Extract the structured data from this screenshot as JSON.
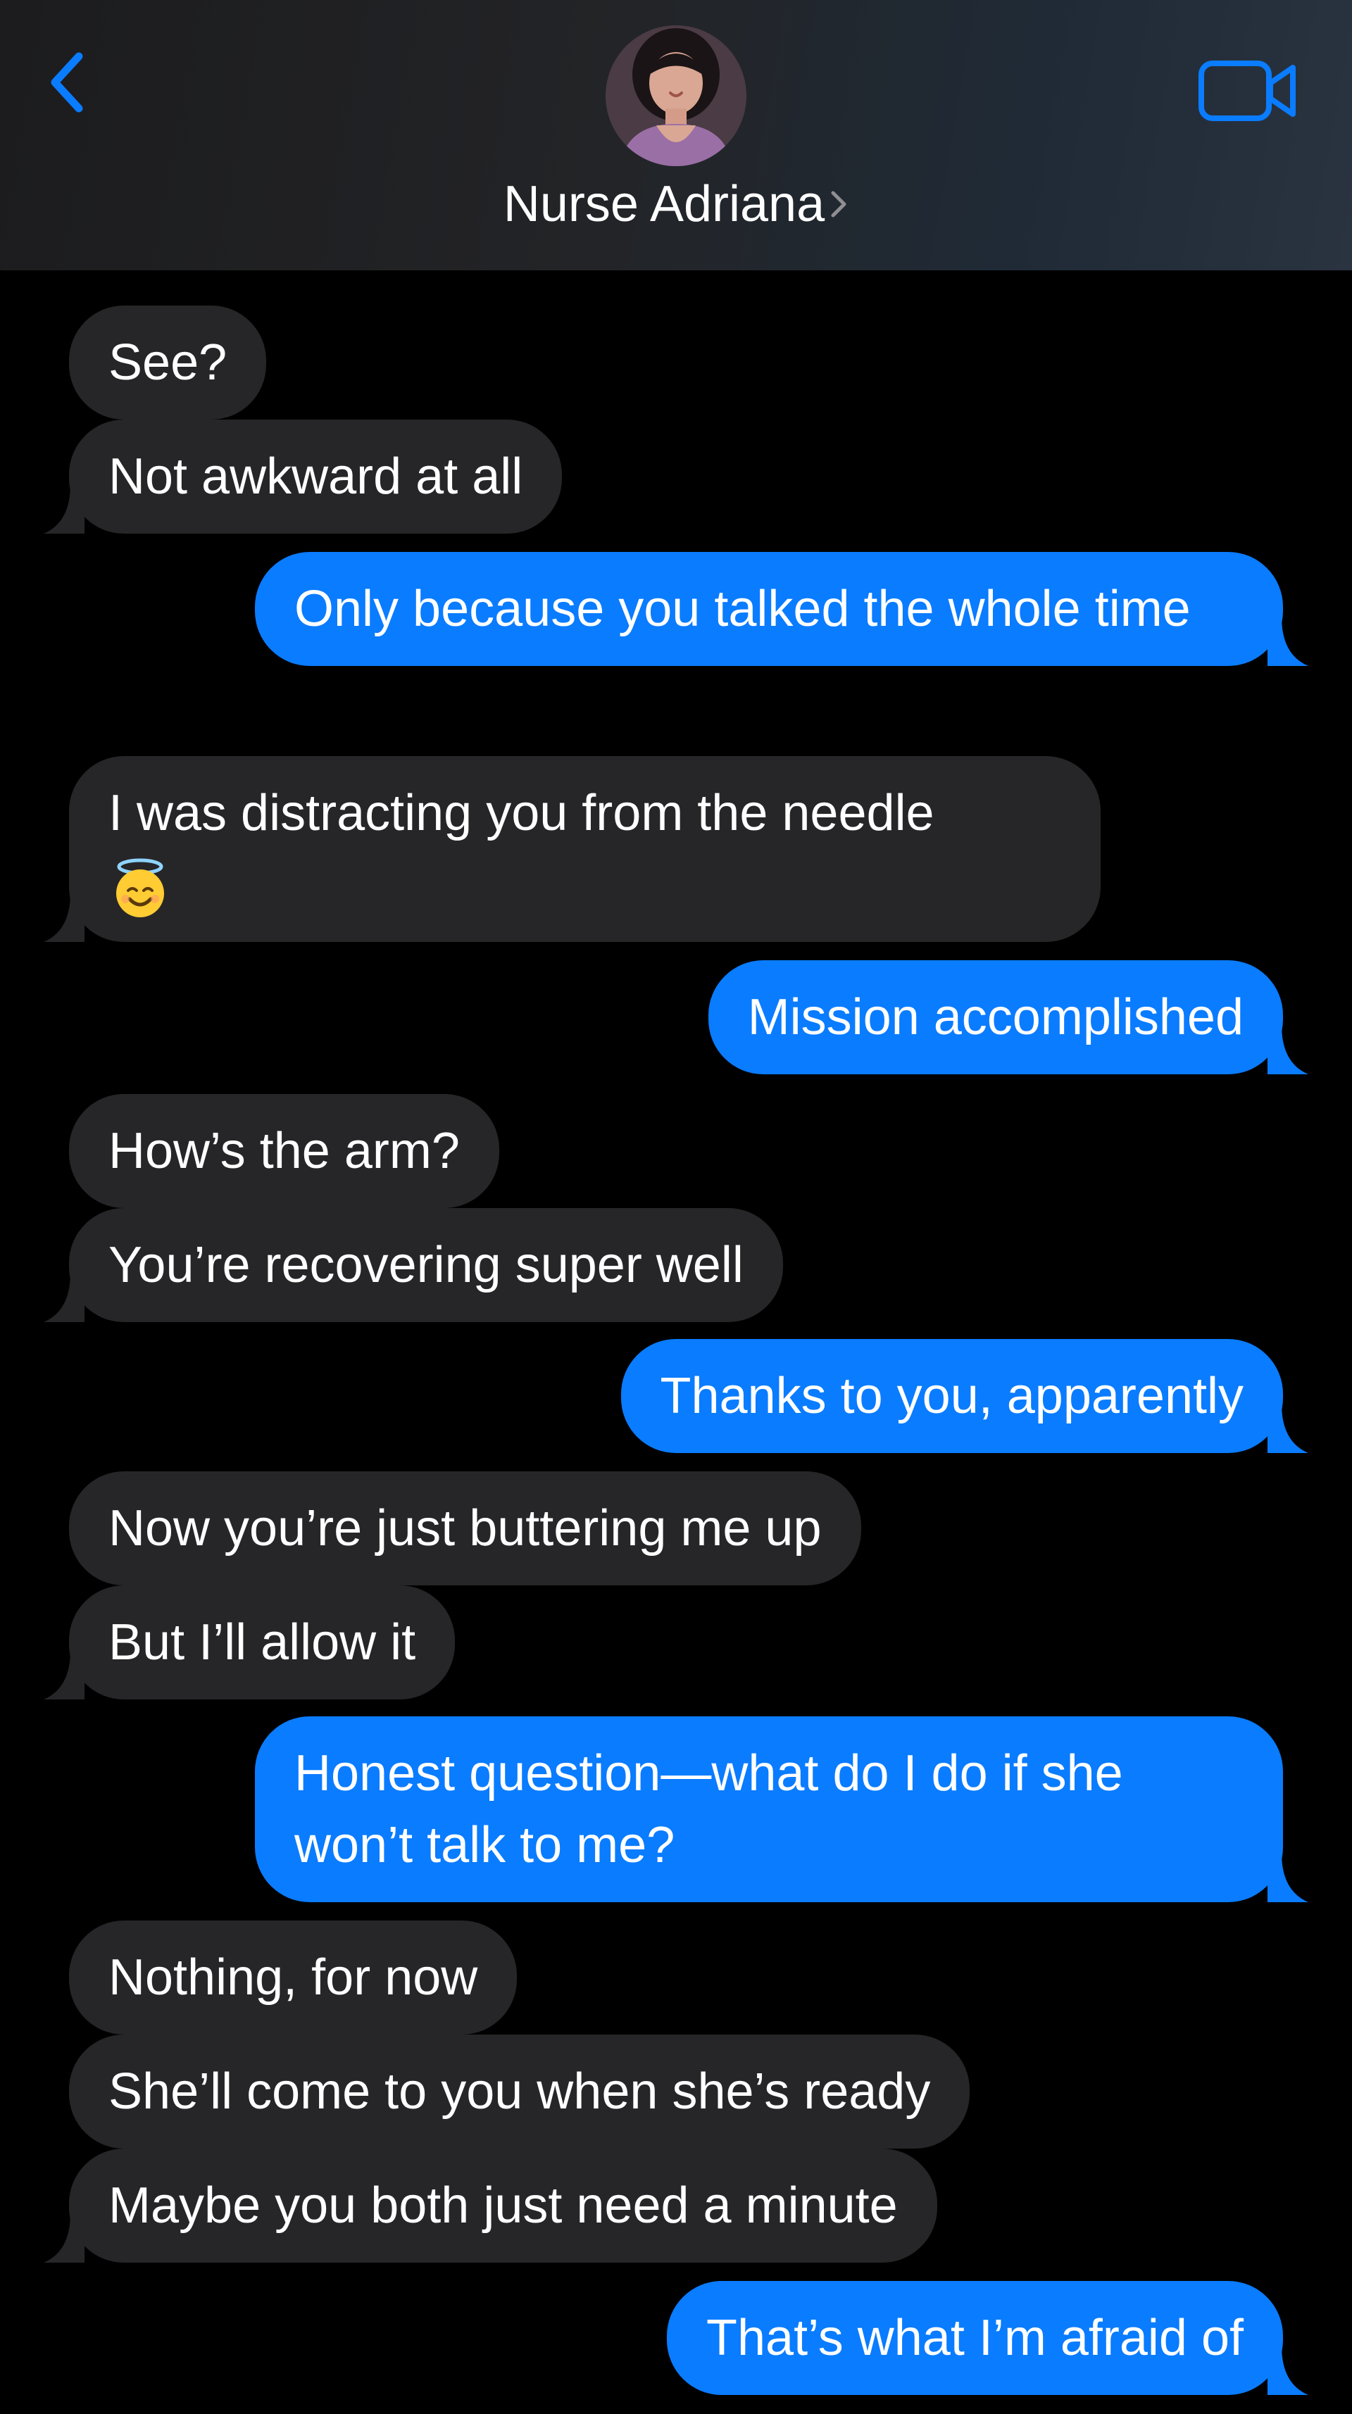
{
  "header": {
    "contact_name": "Nurse Adriana",
    "back_icon": "chevron-left-icon",
    "video_icon": "video-camera-icon",
    "accent_color": "#0a7cff"
  },
  "colors": {
    "incoming_bubble": "#262628",
    "outgoing_bubble": "#0a7cff",
    "background": "#000000",
    "text": "#ffffff"
  },
  "messages": [
    {
      "sender": "them",
      "text": "See?"
    },
    {
      "sender": "them",
      "text": "Not awkward at all"
    },
    {
      "sender": "me",
      "text": "Only because you talked the whole time"
    },
    {
      "sender": "them",
      "text": "I was distracting you from the needle",
      "emoji": "smiling-face-with-halo"
    },
    {
      "sender": "me",
      "text": "Mission accomplished"
    },
    {
      "sender": "them",
      "text": "How’s the arm?"
    },
    {
      "sender": "them",
      "text": "You’re recovering super well"
    },
    {
      "sender": "me",
      "text": "Thanks to you, apparently"
    },
    {
      "sender": "them",
      "text": "Now you’re just buttering me up"
    },
    {
      "sender": "them",
      "text": "But I’ll allow it"
    },
    {
      "sender": "me",
      "text": "Honest question—what do I do if she won’t talk to me?"
    },
    {
      "sender": "them",
      "text": "Nothing, for now"
    },
    {
      "sender": "them",
      "text": "She’ll come to you when she’s ready"
    },
    {
      "sender": "them",
      "text": "Maybe you both just need a minute"
    },
    {
      "sender": "me",
      "text": "That’s what I’m afraid of"
    }
  ]
}
